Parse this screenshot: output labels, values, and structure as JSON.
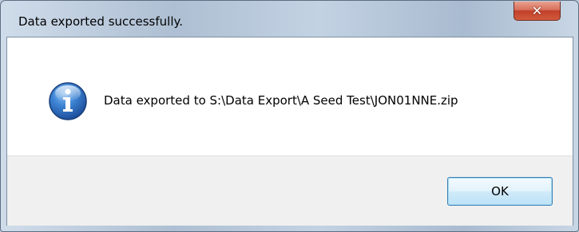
{
  "dialog": {
    "title": "Data exported successfully.",
    "close_glyph": "✕",
    "icon": "info-icon",
    "message": "Data exported to S:\\Data Export\\A Seed Test\\JON01NNE.zip",
    "ok_label": "OK"
  },
  "colors": {
    "close_button": "#c9493a",
    "ok_button_border": "#3c7fb1",
    "info_icon": "#2a66b8",
    "button_area": "#f0f0f0"
  }
}
